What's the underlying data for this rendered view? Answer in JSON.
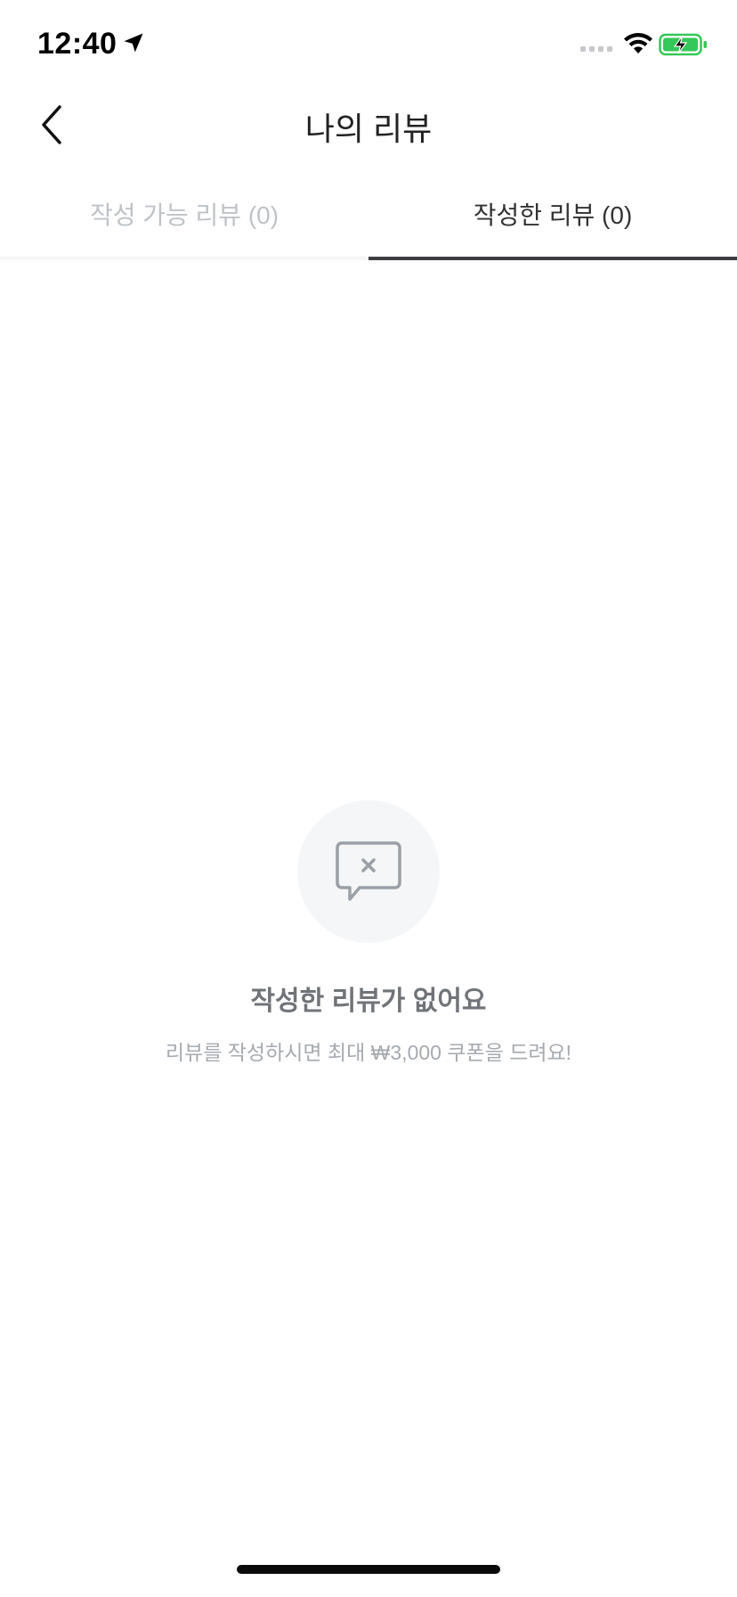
{
  "status_bar": {
    "time": "12:40"
  },
  "header": {
    "title": "나의 리뷰"
  },
  "tabs": [
    {
      "label": "작성 가능 리뷰 (0)",
      "active": false
    },
    {
      "label": "작성한 리뷰 (0)",
      "active": true
    }
  ],
  "empty_state": {
    "title": "작성한 리뷰가 없어요",
    "subtitle": "리뷰를 작성하시면 최대 ₩3,000 쿠폰을 드려요!"
  },
  "colors": {
    "battery_green": "#34c759",
    "tab_active_underline": "#3e3e42",
    "icon_gray": "#9aa0a6",
    "icon_bg": "#f5f6f7"
  },
  "icons": [
    "location-arrow-icon",
    "signal-icon",
    "wifi-icon",
    "battery-charging-icon",
    "back-chevron-icon",
    "chat-bubble-x-icon"
  ]
}
